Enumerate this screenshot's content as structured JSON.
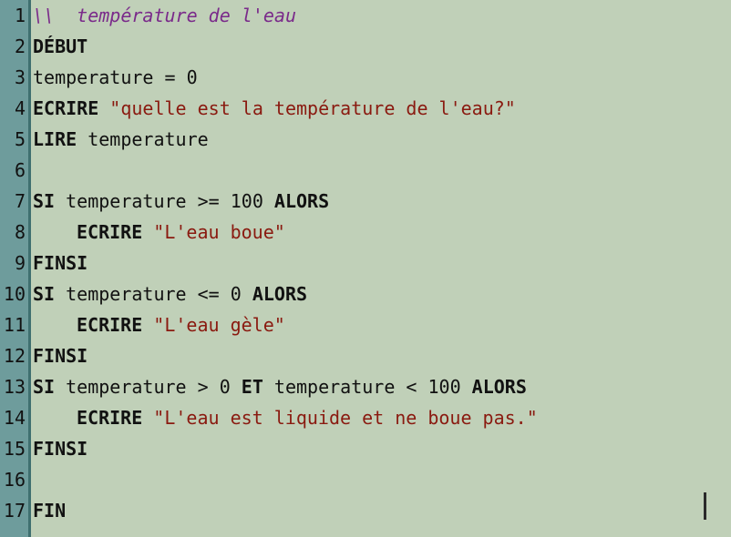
{
  "editor": {
    "lines": [
      {
        "num": "1",
        "parts": [
          {
            "t": "\\\\  température de l'eau",
            "k": "cmt"
          }
        ]
      },
      {
        "num": "2",
        "parts": [
          {
            "t": "DÉBUT",
            "k": "kw"
          }
        ]
      },
      {
        "num": "3",
        "parts": [
          {
            "t": "temperature = 0",
            "k": "plain"
          }
        ]
      },
      {
        "num": "4",
        "parts": [
          {
            "t": "ECRIRE",
            "k": "kw"
          },
          {
            "t": " ",
            "k": "plain"
          },
          {
            "t": "\"quelle est la température de l'eau?\"",
            "k": "str"
          }
        ]
      },
      {
        "num": "5",
        "parts": [
          {
            "t": "LIRE",
            "k": "kw"
          },
          {
            "t": " temperature",
            "k": "plain"
          }
        ]
      },
      {
        "num": "6",
        "parts": []
      },
      {
        "num": "7",
        "parts": [
          {
            "t": "SI",
            "k": "kw"
          },
          {
            "t": " temperature >= 100 ",
            "k": "plain"
          },
          {
            "t": "ALORS",
            "k": "kw"
          }
        ]
      },
      {
        "num": "8",
        "indent": true,
        "parts": [
          {
            "t": "ECRIRE",
            "k": "kw"
          },
          {
            "t": " ",
            "k": "plain"
          },
          {
            "t": "\"L'eau boue\"",
            "k": "str"
          }
        ]
      },
      {
        "num": "9",
        "parts": [
          {
            "t": "FINSI",
            "k": "kw"
          }
        ]
      },
      {
        "num": "10",
        "parts": [
          {
            "t": "SI",
            "k": "kw"
          },
          {
            "t": " temperature <= 0 ",
            "k": "plain"
          },
          {
            "t": "ALORS",
            "k": "kw"
          }
        ]
      },
      {
        "num": "11",
        "indent": true,
        "parts": [
          {
            "t": "ECRIRE",
            "k": "kw"
          },
          {
            "t": " ",
            "k": "plain"
          },
          {
            "t": "\"L'eau gèle\"",
            "k": "str"
          }
        ]
      },
      {
        "num": "12",
        "parts": [
          {
            "t": "FINSI",
            "k": "kw"
          }
        ]
      },
      {
        "num": "13",
        "parts": [
          {
            "t": "SI",
            "k": "kw"
          },
          {
            "t": " temperature > 0 ",
            "k": "plain"
          },
          {
            "t": "ET",
            "k": "kw"
          },
          {
            "t": " temperature < 100 ",
            "k": "plain"
          },
          {
            "t": "ALORS",
            "k": "kw"
          }
        ]
      },
      {
        "num": "14",
        "indent": true,
        "parts": [
          {
            "t": "ECRIRE",
            "k": "kw"
          },
          {
            "t": " ",
            "k": "plain"
          },
          {
            "t": "\"L'eau est liquide et ne boue pas.\"",
            "k": "str"
          }
        ]
      },
      {
        "num": "15",
        "parts": [
          {
            "t": "FINSI",
            "k": "kw"
          }
        ]
      },
      {
        "num": "16",
        "parts": []
      },
      {
        "num": "17",
        "parts": [
          {
            "t": "FIN",
            "k": "kw"
          }
        ]
      }
    ]
  },
  "colors": {
    "background": "#c0d0b8",
    "gutter": "#6e9c9c",
    "keyword": "#111111",
    "string": "#8a1a10",
    "comment": "#7a2a8a"
  }
}
